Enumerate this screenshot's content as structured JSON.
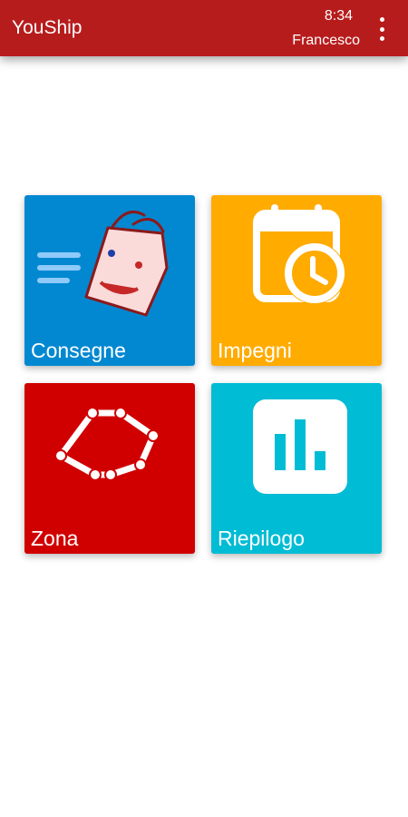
{
  "appbar": {
    "title": "YouShip",
    "time": "8:34",
    "user": "Francesco",
    "menu_icon": "more-vert-icon",
    "color": "#b71c1c"
  },
  "tiles": [
    {
      "label": "Consegne",
      "icon": "shopping-bag-face-icon",
      "color": "#0288d1"
    },
    {
      "label": "Impegni",
      "icon": "calendar-clock-icon",
      "color": "#ffab00"
    },
    {
      "label": "Zona",
      "icon": "zone-polygon-icon",
      "color": "#d00000"
    },
    {
      "label": "Riepilogo",
      "icon": "bar-chart-icon",
      "color": "#00bcd4"
    }
  ]
}
